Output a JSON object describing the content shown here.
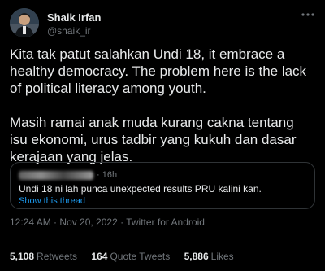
{
  "author": {
    "display_name": "Shaik Irfan",
    "handle": "@shaik_ir"
  },
  "tweet": {
    "paragraphs": [
      "Kita tak patut salahkan Undi 18, it embrace a healthy democracy. The problem here is the lack of political literacy among youth.",
      "Masih ramai anak muda kurang cakna tentang isu ekonomi, urus tadbir yang kukuh dan dasar kerajaan yang jelas."
    ],
    "timestamp": "12:24 AM · Nov 20, 2022 · Twitter for Android"
  },
  "quoted_tweet": {
    "age": "· 16h",
    "text": "Undi 18 ni lah punca unexpected results PRU kalini kan.",
    "show_thread": "Show this thread"
  },
  "stats": {
    "retweets_count": "5,108",
    "retweets_label": "Retweets",
    "quotes_count": "164",
    "quotes_label": "Quote Tweets",
    "likes_count": "5,886",
    "likes_label": "Likes"
  },
  "colors": {
    "background": "#000000",
    "text": "#e7e9ea",
    "muted": "#71767b",
    "link": "#1d9bf0",
    "border": "#2f3336"
  }
}
